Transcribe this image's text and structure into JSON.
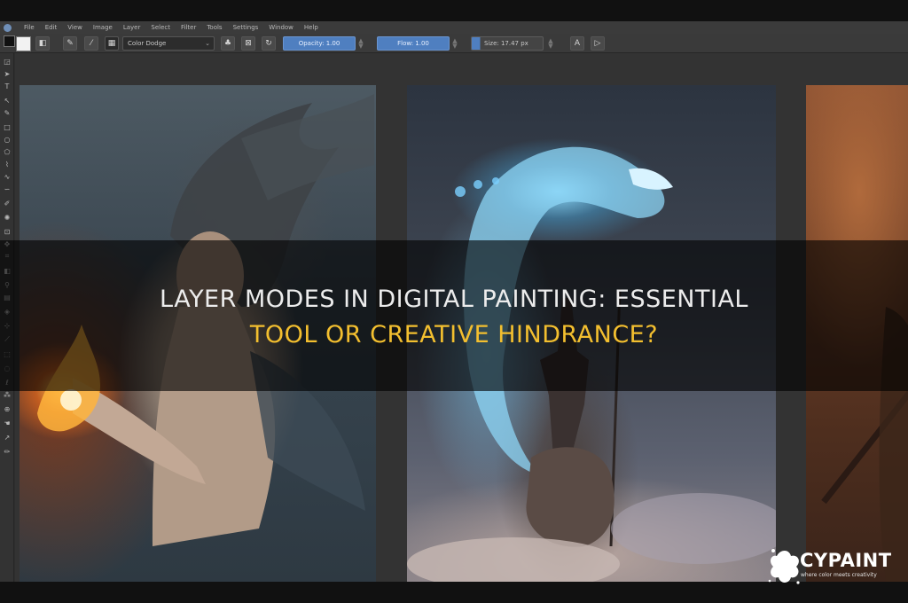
{
  "menu": [
    "File",
    "Edit",
    "View",
    "Image",
    "Layer",
    "Select",
    "Filter",
    "Tools",
    "Settings",
    "Window",
    "Help"
  ],
  "toolbar": {
    "blend_mode": "Color Dodge",
    "opacity_label": "Opacity: 1.00",
    "flow_label": "Flow: 1.00",
    "size_label": "Size: 17.47 px"
  },
  "headline": {
    "line1": "LAYER MODES IN DIGITAL PAINTING: ESSENTIAL",
    "line2": "TOOL OR CREATIVE HINDRANCE?"
  },
  "brand": {
    "name": "CYPAINT",
    "tagline": "where color meets creativity"
  },
  "colors": {
    "headline_line1": "#ececec",
    "headline_line2": "#f3bf2f",
    "field_accent": "#4f7fc0"
  },
  "icons": [
    "app-logo-icon",
    "brush-tool-icon",
    "eraser-icon",
    "pattern-icon",
    "reset-icon",
    "preserve-alpha-icon",
    "reload-icon",
    "mirror-h-icon",
    "mirror-v-icon",
    "splat-logo-icon"
  ]
}
